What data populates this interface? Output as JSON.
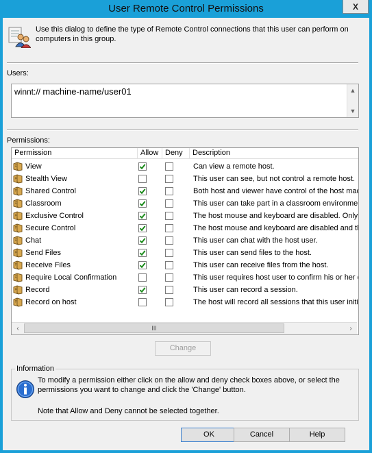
{
  "window": {
    "title": "User Remote Control Permissions",
    "close_glyph": "X"
  },
  "intro": {
    "text": "Use this dialog to define the type of Remote Control connections that this user can perform on computers in this group.",
    "icon": "users-icon"
  },
  "users": {
    "label": "Users:",
    "prefix": "winnt://",
    "value": "machine-name/user01"
  },
  "permissions": {
    "label": "Permissions:",
    "columns": {
      "permission": "Permission",
      "allow": "Allow",
      "deny": "Deny",
      "description": "Description"
    },
    "rows": [
      {
        "name": "View",
        "allow": true,
        "deny": false,
        "description": "Can view a remote host."
      },
      {
        "name": "Stealth View",
        "allow": false,
        "deny": false,
        "description": "This user can see, but not control a remote host."
      },
      {
        "name": "Shared Control",
        "allow": true,
        "deny": false,
        "description": "Both host and viewer have control of the host mac"
      },
      {
        "name": "Classroom",
        "allow": true,
        "deny": false,
        "description": "This user can take part in a classroom environment"
      },
      {
        "name": "Exclusive Control",
        "allow": true,
        "deny": false,
        "description": "The host mouse and keyboard are disabled. Only t"
      },
      {
        "name": "Secure Control",
        "allow": true,
        "deny": false,
        "description": "The host mouse and keyboard are disabled and th"
      },
      {
        "name": "Chat",
        "allow": true,
        "deny": false,
        "description": "This user can chat with the host user."
      },
      {
        "name": "Send Files",
        "allow": true,
        "deny": false,
        "description": "This user can send files to the host."
      },
      {
        "name": "Receive Files",
        "allow": true,
        "deny": false,
        "description": "This user can receive files from the host."
      },
      {
        "name": "Require Local Confirmation",
        "allow": false,
        "deny": false,
        "description": "This user requires host user to confirm his or her c"
      },
      {
        "name": "Record",
        "allow": true,
        "deny": false,
        "description": "This user can record a session."
      },
      {
        "name": "Record on host",
        "allow": false,
        "deny": false,
        "description": "The host will record all sessions that this user initia"
      }
    ],
    "scroll_thumb": "III"
  },
  "buttons": {
    "change": "Change",
    "ok": "OK",
    "cancel": "Cancel",
    "help": "Help"
  },
  "information": {
    "label": "Information",
    "line1": "To modify a permission either click on the allow and deny check boxes above, or select the",
    "line2": "permissions you want to change and click the 'Change' button.",
    "note": "Note that Allow and Deny cannot be selected together.",
    "icon": "info-icon"
  },
  "colors": {
    "titlebar": "#1aa0d8",
    "check": "#1a8a1a",
    "dialog": "#f0f0f0"
  }
}
